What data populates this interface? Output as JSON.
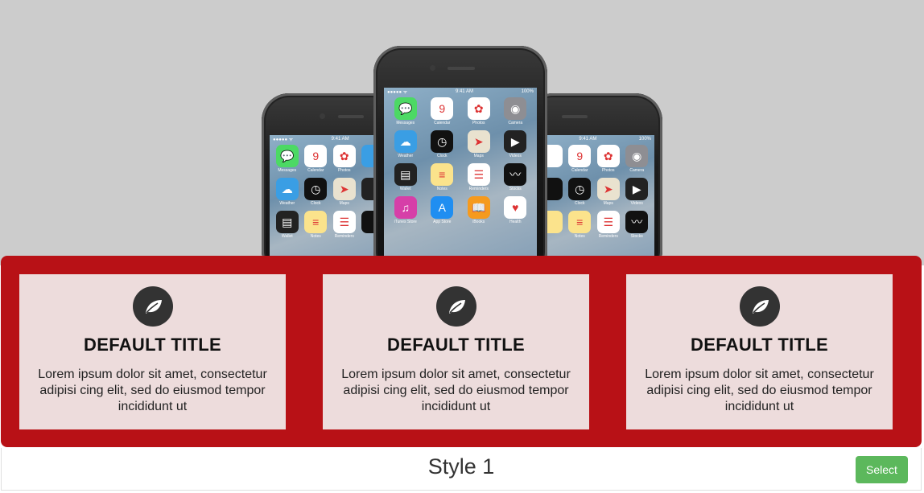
{
  "hero": {
    "image_alt": "three iPhones",
    "center_phone": {
      "time": "9:41 AM",
      "battery": "100%",
      "apps": [
        {
          "label": "Messages",
          "color": "#4cd964",
          "glyph": "💬"
        },
        {
          "label": "Calendar",
          "color": "#ffffff",
          "glyph": "9"
        },
        {
          "label": "Photos",
          "color": "#ffffff",
          "glyph": "✿"
        },
        {
          "label": "Camera",
          "color": "#8e8e93",
          "glyph": "◉"
        },
        {
          "label": "Weather",
          "color": "#3a9ee4",
          "glyph": "☁"
        },
        {
          "label": "Clock",
          "color": "#111111",
          "glyph": "◷"
        },
        {
          "label": "Maps",
          "color": "#e9e2cf",
          "glyph": "➤"
        },
        {
          "label": "Videos",
          "color": "#222222",
          "glyph": "▶"
        },
        {
          "label": "Wallet",
          "color": "#222222",
          "glyph": "▤"
        },
        {
          "label": "Notes",
          "color": "#fbe38c",
          "glyph": "≡"
        },
        {
          "label": "Reminders",
          "color": "#ffffff",
          "glyph": "☰"
        },
        {
          "label": "Stocks",
          "color": "#111111",
          "glyph": "〰"
        },
        {
          "label": "iTunes Store",
          "color": "#d63fa8",
          "glyph": "♫"
        },
        {
          "label": "App Store",
          "color": "#1f8ef1",
          "glyph": "A"
        },
        {
          "label": "iBooks",
          "color": "#f59a1e",
          "glyph": "📖"
        },
        {
          "label": "Health",
          "color": "#ffffff",
          "glyph": "♥"
        }
      ]
    },
    "side_phone_left": {
      "time": "9:41 AM",
      "apps": [
        {
          "label": "Messages",
          "color": "#4cd964",
          "glyph": "💬"
        },
        {
          "label": "Calendar",
          "color": "#ffffff",
          "glyph": "9"
        },
        {
          "label": "Photos",
          "color": "#ffffff",
          "glyph": "✿"
        },
        {
          "label": "",
          "color": "#3a9ee4",
          "glyph": ""
        },
        {
          "label": "Weather",
          "color": "#3a9ee4",
          "glyph": "☁"
        },
        {
          "label": "Clock",
          "color": "#111111",
          "glyph": "◷"
        },
        {
          "label": "Maps",
          "color": "#e9e2cf",
          "glyph": "➤"
        },
        {
          "label": "",
          "color": "#222222",
          "glyph": ""
        },
        {
          "label": "Wallet",
          "color": "#222222",
          "glyph": "▤"
        },
        {
          "label": "Notes",
          "color": "#fbe38c",
          "glyph": "≡"
        },
        {
          "label": "Reminders",
          "color": "#ffffff",
          "glyph": "☰"
        },
        {
          "label": "",
          "color": "#111111",
          "glyph": ""
        }
      ]
    },
    "side_phone_right": {
      "time": "9:41 AM",
      "battery": "100%",
      "apps": [
        {
          "label": "",
          "color": "#ffffff",
          "glyph": ""
        },
        {
          "label": "Calendar",
          "color": "#ffffff",
          "glyph": "9"
        },
        {
          "label": "Photos",
          "color": "#ffffff",
          "glyph": "✿"
        },
        {
          "label": "Camera",
          "color": "#8e8e93",
          "glyph": "◉"
        },
        {
          "label": "",
          "color": "#111111",
          "glyph": ""
        },
        {
          "label": "Clock",
          "color": "#111111",
          "glyph": "◷"
        },
        {
          "label": "Maps",
          "color": "#e9e2cf",
          "glyph": "➤"
        },
        {
          "label": "Videos",
          "color": "#222222",
          "glyph": "▶"
        },
        {
          "label": "",
          "color": "#fbe38c",
          "glyph": ""
        },
        {
          "label": "Notes",
          "color": "#fbe38c",
          "glyph": "≡"
        },
        {
          "label": "Reminders",
          "color": "#ffffff",
          "glyph": "☰"
        },
        {
          "label": "Stocks",
          "color": "#111111",
          "glyph": "〰"
        }
      ]
    }
  },
  "cards": [
    {
      "icon": "leaf-icon",
      "title": "DEFAULT TITLE",
      "text": "Lorem ipsum dolor sit amet, consectetur adipisi cing elit, sed do eiusmod tempor incididunt ut"
    },
    {
      "icon": "leaf-icon",
      "title": "DEFAULT TITLE",
      "text": "Lorem ipsum dolor sit amet, consectetur adipisi cing elit, sed do eiusmod tempor incididunt ut"
    },
    {
      "icon": "leaf-icon",
      "title": "DEFAULT TITLE",
      "text": "Lorem ipsum dolor sit amet, consectetur adipisi cing elit, sed do eiusmod tempor incididunt ut"
    }
  ],
  "footer": {
    "style_label": "Style 1",
    "select_label": "Select"
  },
  "colors": {
    "panel_red": "#b81116",
    "card_bg": "#eddcdc",
    "icon_circle": "#333333",
    "select_green": "#5cb85c",
    "hero_bg": "#cccccc"
  }
}
